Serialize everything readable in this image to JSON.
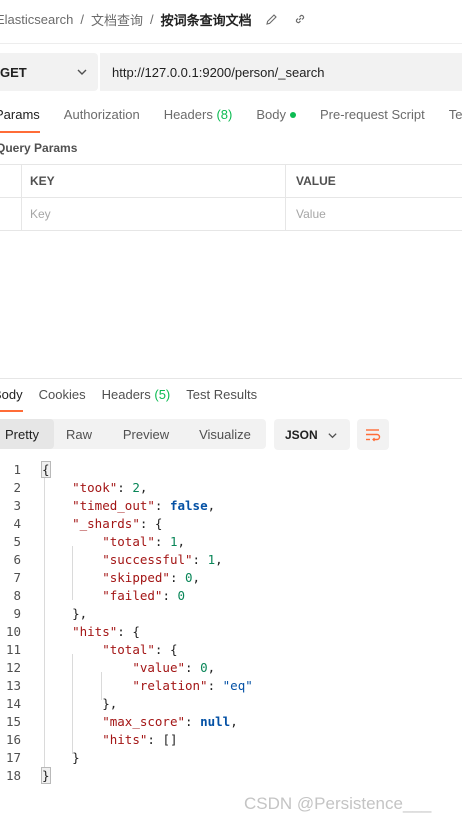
{
  "breadcrumb": {
    "items": [
      "Elasticsearch",
      "文档查询"
    ],
    "current": "按词条查询文档",
    "separator": "/"
  },
  "request": {
    "method": "GET",
    "url": "http://127.0.0.1:9200/person/_search"
  },
  "request_tabs": [
    {
      "label": "Params"
    },
    {
      "label": "Authorization"
    },
    {
      "label": "Headers",
      "count": "(8)"
    },
    {
      "label": "Body"
    },
    {
      "label": "Pre-request Script"
    },
    {
      "label": "Tests"
    }
  ],
  "query_params": {
    "title": "Query Params",
    "columns": [
      "KEY",
      "VALUE"
    ],
    "key_placeholder": "Key",
    "value_placeholder": "Value"
  },
  "response_tabs": [
    {
      "label": "Body"
    },
    {
      "label": "Cookies"
    },
    {
      "label": "Headers",
      "count": "(5)"
    },
    {
      "label": "Test Results"
    }
  ],
  "view_modes": [
    "Pretty",
    "Raw",
    "Preview",
    "Visualize"
  ],
  "format": "JSON",
  "code_lines": [
    "1",
    "2",
    "3",
    "4",
    "5",
    "6",
    "7",
    "8",
    "9",
    "10",
    "11",
    "12",
    "13",
    "14",
    "15",
    "16",
    "17",
    "18"
  ],
  "response_json": {
    "took_key": "\"took\"",
    "took_val": "2",
    "timed_out_key": "\"timed_out\"",
    "timed_out_val": "false",
    "shards_key": "\"_shards\"",
    "total_key": "\"total\"",
    "total_val": "1",
    "successful_key": "\"successful\"",
    "successful_val": "1",
    "skipped_key": "\"skipped\"",
    "skipped_val": "0",
    "failed_key": "\"failed\"",
    "failed_val": "0",
    "hits_key": "\"hits\"",
    "hits_total_key": "\"total\"",
    "value_key": "\"value\"",
    "value_val": "0",
    "relation_key": "\"relation\"",
    "relation_val": "\"eq\"",
    "max_score_key": "\"max_score\"",
    "max_score_val": "null",
    "hits_inner_key": "\"hits\"",
    "hits_inner_val": "[]"
  },
  "watermark": "CSDN @Persistence___",
  "colors": {
    "accent": "#ff6c37",
    "count": "#0cbb52",
    "json_key": "#a31515",
    "json_number": "#098658",
    "json_keyword": "#0451a5"
  }
}
